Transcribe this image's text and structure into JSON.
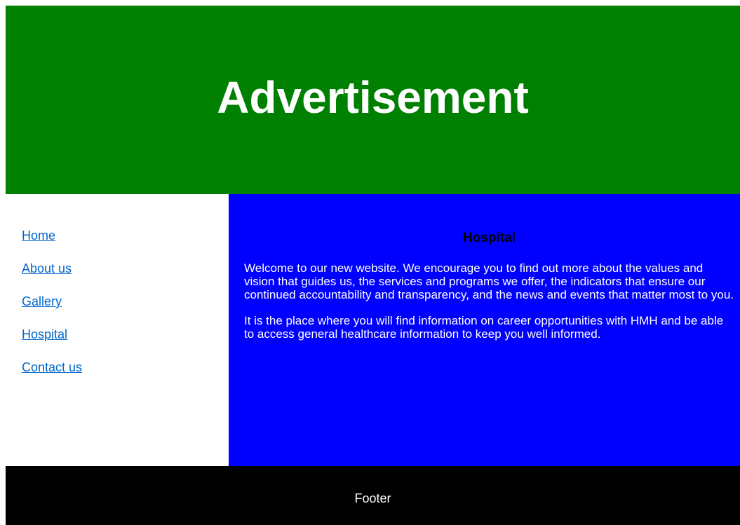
{
  "colors": {
    "header_bg": "#008000",
    "content_bg": "#0000ff",
    "footer_bg": "#000000",
    "link": "#0066cc"
  },
  "header": {
    "title": "Advertisement"
  },
  "sidebar": {
    "items": [
      {
        "label": "Home"
      },
      {
        "label": "About us"
      },
      {
        "label": "Gallery"
      },
      {
        "label": "Hospital"
      },
      {
        "label": "Contact us"
      }
    ]
  },
  "main": {
    "title": "Hospital",
    "paragraphs": [
      "Welcome to our new website. We encourage you to find out more about the values and vision that guides us, the services and programs we offer, the indicators that ensure our continued accountability and transparency, and the news and events that matter most to you.",
      "It is the place where you will find information on career opportunities with HMH and be able to access general healthcare information to keep you well informed."
    ]
  },
  "footer": {
    "text": "Footer"
  }
}
